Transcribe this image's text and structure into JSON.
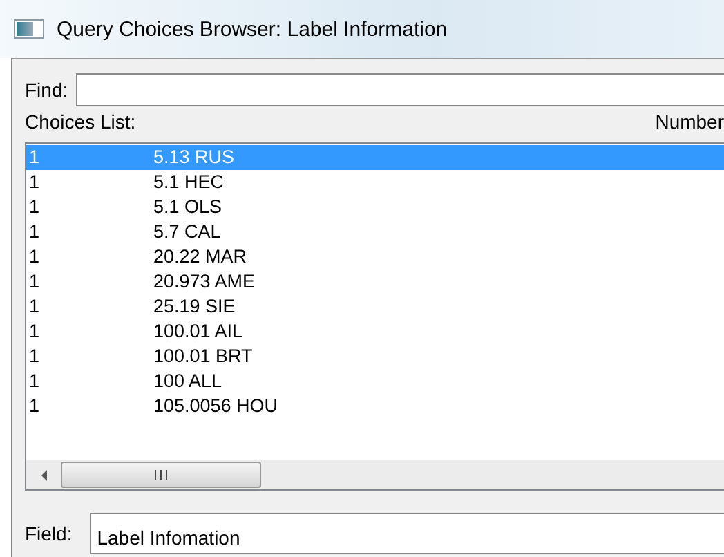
{
  "window": {
    "title": "Query Choices Browser: Label Information"
  },
  "find": {
    "label": "Find:"
  },
  "list": {
    "label": "Choices List:",
    "column_2_label": "Number",
    "rows": [
      {
        "count": "1",
        "choice": "5.13 RUS",
        "selected": true
      },
      {
        "count": "1",
        "choice": "5.1 HEC",
        "selected": false
      },
      {
        "count": "1",
        "choice": "5.1 OLS",
        "selected": false
      },
      {
        "count": "1",
        "choice": "5.7 CAL",
        "selected": false
      },
      {
        "count": "1",
        "choice": "20.22 MAR",
        "selected": false
      },
      {
        "count": "1",
        "choice": "20.973 AME",
        "selected": false
      },
      {
        "count": "1",
        "choice": "25.19 SIE",
        "selected": false
      },
      {
        "count": "1",
        "choice": "100.01 AIL",
        "selected": false
      },
      {
        "count": "1",
        "choice": "100.01 BRT",
        "selected": false
      },
      {
        "count": "1",
        "choice": "100 ALL",
        "selected": false
      },
      {
        "count": "1",
        "choice": "105.0056 HOU",
        "selected": false
      }
    ]
  },
  "field": {
    "label": "Field:",
    "value": "Label Infomation"
  }
}
